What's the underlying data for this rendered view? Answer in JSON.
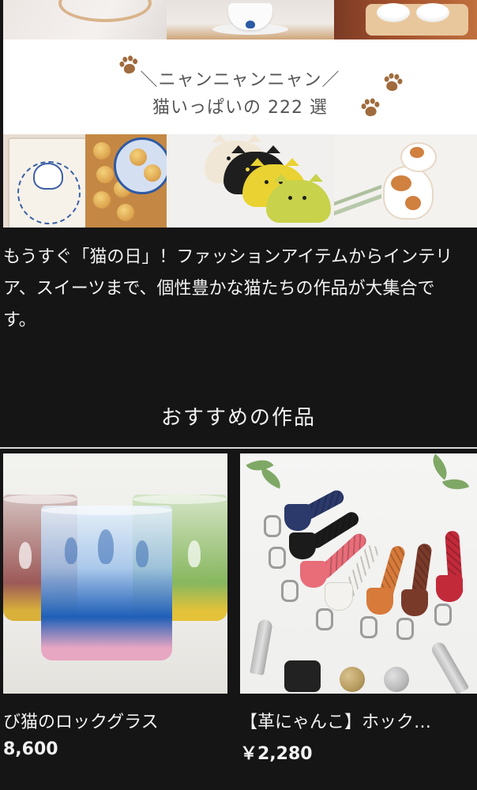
{
  "banner": {
    "tagline": "＼ニャンニャンニャン／",
    "title": "猫いっぱいの 222 選"
  },
  "intro": {
    "lines": [
      "もうすぐ「猫の日」！ファッションアイテムからインテリ",
      "ア、スイーツまで、個性豊かな猫たちの作品が大集合で",
      "す。"
    ]
  },
  "section": {
    "heading": "おすすめの作品"
  },
  "products": [
    {
      "title": "び猫のロックグラス",
      "price": "8,600"
    },
    {
      "title": "【革にゃんこ】ホック…",
      "price": "￥2,280"
    }
  ],
  "colors": {
    "background": "#151515",
    "text": "#f2f2f2",
    "heading_text": "#555555",
    "paw": "#a06b3d"
  }
}
